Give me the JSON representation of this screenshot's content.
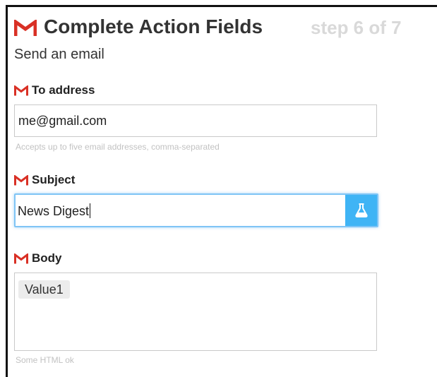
{
  "header": {
    "title": "Complete Action Fields",
    "step": "step 6 of 7"
  },
  "action": {
    "name": "Send an email"
  },
  "fields": {
    "to_address": {
      "label": "To address",
      "value": "me@gmail.com",
      "help": "Accepts up to five email addresses, comma-separated"
    },
    "subject": {
      "label": "Subject",
      "value": "News Digest",
      "add_ingredient_icon": "flask-icon"
    },
    "body": {
      "label": "Body",
      "token": "Value1",
      "help": "Some HTML ok"
    }
  },
  "colors": {
    "gmail_red": "#d93025",
    "focus_border": "#7fc4f5",
    "ingredient_button": "#3fb4f5",
    "step_text": "#d9d9d9",
    "help_text": "#c2c2c2"
  },
  "icons": {
    "service": "gmail-icon"
  }
}
